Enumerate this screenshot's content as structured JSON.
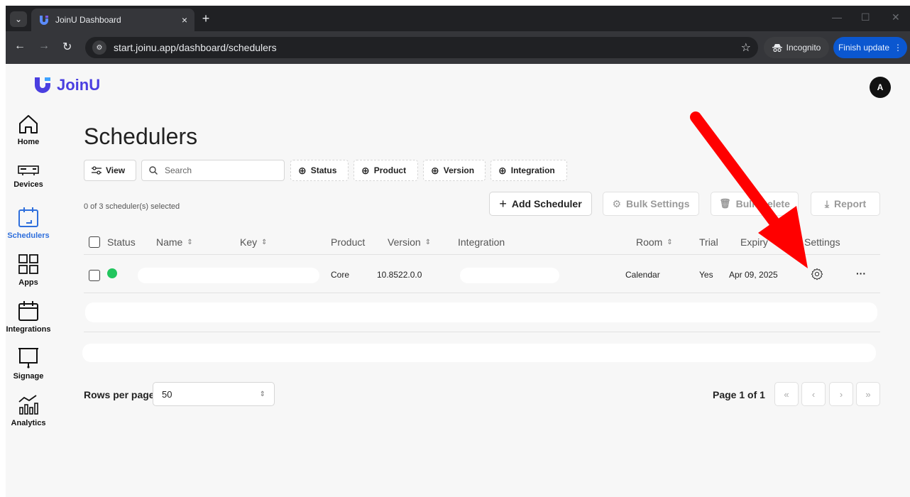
{
  "browser": {
    "tab_title": "JoinU Dashboard",
    "tab_close": "×",
    "new_tab": "+",
    "url": "start.joinu.app/dashboard/schedulers",
    "incognito_label": "Incognito",
    "update_label": "Finish update",
    "minimize": "—",
    "maximize": "☐",
    "close": "✕"
  },
  "app": {
    "logo_text": "JoinU",
    "brand_color": "#4a3fe0",
    "avatar_initial": "A"
  },
  "sidebar": {
    "items": [
      {
        "label": "Home"
      },
      {
        "label": "Devices"
      },
      {
        "label": "Schedulers"
      },
      {
        "label": "Apps"
      },
      {
        "label": "Integrations"
      },
      {
        "label": "Signage"
      },
      {
        "label": "Analytics"
      }
    ],
    "active_color": "#2f6fdc"
  },
  "page": {
    "title": "Schedulers",
    "filters": {
      "view": "View",
      "search_placeholder": "Search",
      "status": "Status",
      "product": "Product",
      "version": "Version",
      "integration": "Integration"
    },
    "selected_text": "0 of 3 scheduler(s) selected",
    "actions": {
      "add": "Add Scheduler",
      "bulk_settings": "Bulk Settings",
      "bulk_delete": "Bulk Delete",
      "report": "Report"
    }
  },
  "table": {
    "headers": {
      "status": "Status",
      "name": "Name",
      "key": "Key",
      "product": "Product",
      "version": "Version",
      "integration": "Integration",
      "room": "Room",
      "trial": "Trial",
      "expiry": "Expiry",
      "settings": "Settings"
    },
    "rows": [
      {
        "status_color": "#22c55e",
        "product": "Core",
        "version": "10.8522.0.0",
        "room": "Calendar",
        "trial": "Yes",
        "expiry": "Apr 09, 2025",
        "settings_icon": "gear-icon",
        "more": "···"
      }
    ]
  },
  "pagination": {
    "rows_per_page_label": "Rows per page",
    "rows_per_page_value": "50",
    "page_text": "Page 1 of 1"
  },
  "annotation": {
    "arrow_color": "#ff0000"
  }
}
